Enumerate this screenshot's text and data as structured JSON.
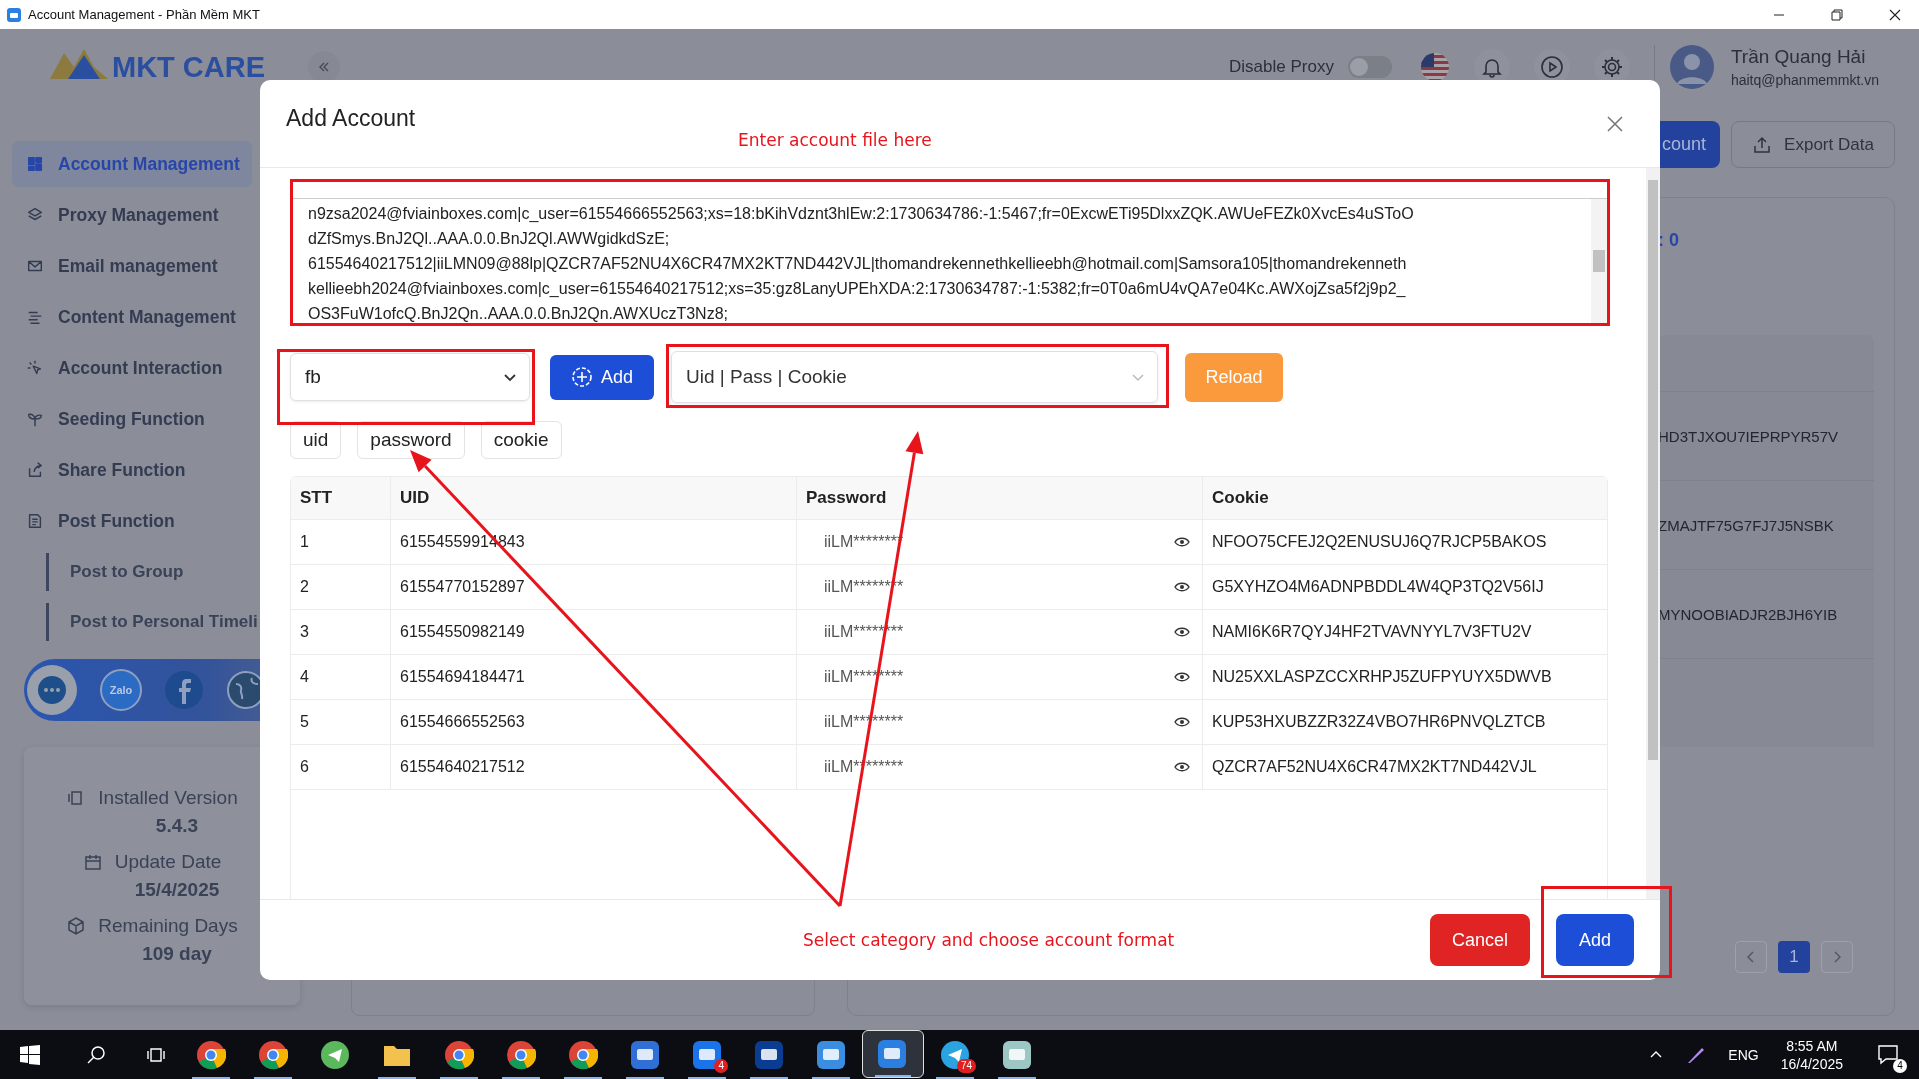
{
  "window": {
    "title": "Account Management - Phần Mềm MKT"
  },
  "brand": {
    "name": "MKT CARE"
  },
  "sidebar": {
    "items": [
      {
        "label": "Account Management",
        "selected": true
      },
      {
        "label": "Proxy Management",
        "selected": false
      },
      {
        "label": "Email management",
        "selected": false
      },
      {
        "label": "Content Management",
        "selected": false
      },
      {
        "label": "Account Interaction",
        "selected": false
      },
      {
        "label": "Seeding Function",
        "selected": false
      },
      {
        "label": "Share Function",
        "selected": false
      },
      {
        "label": "Post Function",
        "selected": false,
        "children": [
          {
            "label": "Post to Group",
            "selected": false
          },
          {
            "label": "Post to Personal Timeli",
            "selected": false
          }
        ]
      }
    ],
    "zalo_label": "Zalo",
    "info": [
      {
        "kind": "version",
        "label": "Installed Version",
        "value": "5.4.3"
      },
      {
        "kind": "date",
        "label": "Update Date",
        "value": "15/4/2025"
      },
      {
        "kind": "box",
        "label": "Remaining Days",
        "value": "109 day"
      }
    ]
  },
  "header": {
    "proxy_label": "Disable Proxy",
    "proxy_on": false,
    "user": {
      "name": "Trần Quang Hải",
      "email": "haitq@phanmemmkt.vn"
    }
  },
  "toolbar": {
    "primary": "count",
    "export": "Export Data"
  },
  "background_card": {
    "stat": ": 0",
    "rows": [
      "HD3TJXOU7IEPRPYR57V",
      "ZMAJTF75G7FJ7J5NSBK",
      "MYNOOBIADJR2BJH6YIB"
    ],
    "pages": [
      {
        "label": "1",
        "selected": true
      }
    ]
  },
  "modal": {
    "title": "Add Account",
    "input_lines": [
      "n9zsa2024@fviainboxes.com|c_user=61554666552563;xs=18:bKihVdznt3hlEw:2:1730634786:-1:5467;fr=0ExcwETi95DlxxZQK.AWUeFEZk0XvcEs4uSToO",
      "dZfSmys.BnJ2Ql..AAA.0.0.BnJ2Ql.AWWgidkdSzE;",
      "61554640217512|iiLMN09@88lp|QZCR7AF52NU4X6CR47MX2KT7ND442VJL|thomandrekennethkellieebh@hotmail.com|Samsora105|thomandrekenneth",
      "kellieebh2024@fviainboxes.com|c_user=61554640217512;xs=35:gz8LanyUPEhXDA:2:1730634787:-1:5382;fr=0T0a6mU4vQA7e04Kc.AWXojZsa5f2j9p2_",
      "OS3FuW1ofcQ.BnJ2Qn..AAA.0.0.BnJ2Qn.AWXUczT3Nz8;"
    ],
    "category": "fb",
    "add_label": "Add",
    "format": "Uid | Pass | Cookie",
    "reload_label": "Reload",
    "fields": [
      "uid",
      "password",
      "cookie"
    ],
    "table": {
      "columns": [
        "STT",
        "UID",
        "Password",
        "Cookie"
      ],
      "rows": [
        {
          "stt": "1",
          "uid": "61554559914843",
          "password": "iiLM********",
          "cookie": "NFOO75CFEJ2Q2ENUSUJ6Q7RJCP5BAKOS"
        },
        {
          "stt": "2",
          "uid": "61554770152897",
          "password": "iiLM********",
          "cookie": "G5XYHZO4M6ADNPBDDL4W4QP3TQ2V56IJ"
        },
        {
          "stt": "3",
          "uid": "61554550982149",
          "password": "iiLM********",
          "cookie": "NAMI6K6R7QYJ4HF2TVAVNYYL7V3FTU2V"
        },
        {
          "stt": "4",
          "uid": "61554694184471",
          "password": "iiLM********",
          "cookie": "NU25XXLASPZCCXRHPJ5ZUFPYUYX5DWVB"
        },
        {
          "stt": "5",
          "uid": "61554666552563",
          "password": "iiLM********",
          "cookie": "KUP53HXUBZZR32Z4VBO7HR6PNVQLZTCB"
        },
        {
          "stt": "6",
          "uid": "61554640217512",
          "password": "iiLM********",
          "cookie": "QZCR7AF52NU4X6CR47MX2KT7ND442VJL"
        }
      ]
    },
    "cancel_label": "Cancel",
    "confirm_label": "Add"
  },
  "annotations": {
    "notes": [
      "Enter account file here",
      "Select category and choose account format"
    ]
  },
  "taskbar": {
    "apps": [
      {
        "kind": "browser",
        "running": true,
        "selected": false
      },
      {
        "kind": "browser",
        "running": true,
        "selected": false
      },
      {
        "kind": "green",
        "running": false,
        "selected": false
      },
      {
        "kind": "folder",
        "running": true,
        "selected": false
      },
      {
        "kind": "browser",
        "running": true,
        "selected": false
      },
      {
        "kind": "browser",
        "running": true,
        "selected": false
      },
      {
        "kind": "browser",
        "running": true,
        "selected": false
      },
      {
        "kind": "monitor",
        "running": true,
        "selected": false
      },
      {
        "kind": "chat",
        "running": true,
        "selected": false,
        "badge": "4"
      },
      {
        "kind": "wave",
        "running": true,
        "selected": false
      },
      {
        "kind": "cloud",
        "running": true,
        "selected": false
      },
      {
        "kind": "care",
        "running": true,
        "selected": true
      },
      {
        "kind": "send",
        "running": true,
        "selected": false,
        "badge": "74"
      },
      {
        "kind": "notes",
        "running": true,
        "selected": false
      }
    ],
    "language": "ENG",
    "time": "8:55 AM",
    "date": "16/4/2025",
    "notifications": "4"
  }
}
